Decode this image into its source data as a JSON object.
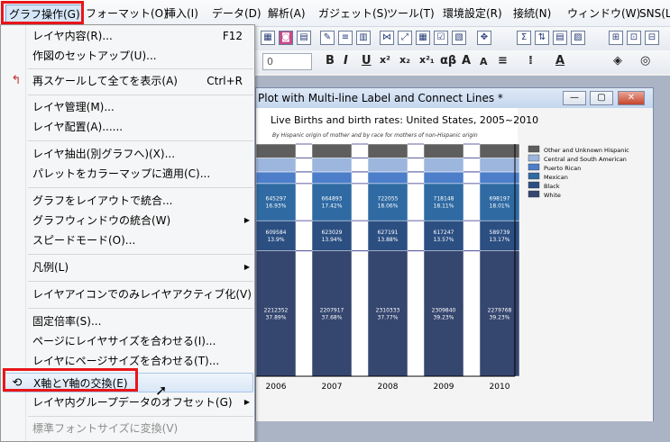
{
  "menubar": {
    "items": [
      "グラフ操作(G)",
      "フォーマット(O)",
      "挿入(I)",
      "データ(D)",
      "解析(A)",
      "ガジェット(S)",
      "ツール(T)",
      "環境設定(R)",
      "接続(N)",
      "ウィンドウ(W)",
      "SNS(L)"
    ]
  },
  "toolbar": {
    "font_size_value": "0",
    "format_glyphs": [
      "B",
      "I",
      "U",
      "x²",
      "x₂",
      "x²₁",
      "αβ",
      "A",
      "A"
    ]
  },
  "graph_window": {
    "title": "Plot with Multi-line Label and Connect Lines *",
    "buttons": [
      "—",
      "▢",
      "✕"
    ]
  },
  "colors": {
    "accent_red": "#e8161b",
    "series": [
      "#35466f",
      "#2c4f82",
      "#2f6aa3",
      "#4c7ec9",
      "#9cb6dd",
      "#5e5e5e"
    ]
  },
  "chart_data": {
    "type": "bar",
    "stacked": true,
    "title": "Live Births and birth rates: United States, 2005~2010",
    "subtitle": "By Hispanic origin of mother and by race for mothers of non-Hispanic origin",
    "categories": [
      "2006",
      "2007",
      "2008",
      "2009",
      "2010"
    ],
    "series": [
      {
        "name": "White",
        "values": [
          2212352,
          2207917,
          2310333,
          2309840,
          2279768
        ],
        "labels": [
          "2212352\n37.89%",
          "2207917\n37.68%",
          "2310333\n37.77%",
          "2309840\n39.23%",
          "2279768\n39.23%"
        ]
      },
      {
        "name": "Black",
        "values": [
          609584,
          623029,
          627191,
          617247,
          589739
        ],
        "labels": [
          "609584\n13.9%",
          "623029\n13.94%",
          "627191\n13.88%",
          "617247\n13.57%",
          "589739\n13.17%"
        ]
      },
      {
        "name": "Mexican",
        "values": [
          645297,
          664893,
          722055,
          718148,
          698197
        ],
        "labels": [
          "645297\n16.93%",
          "664893\n17.42%",
          "722055\n18.06%",
          "718148\n18.11%",
          "698197\n18.01%"
        ]
      },
      {
        "name": "Puerto Rican",
        "values": [
          0,
          0,
          0,
          0,
          0
        ]
      },
      {
        "name": "Central and South American",
        "values": [
          0,
          0,
          0,
          0,
          0
        ]
      },
      {
        "name": "Other and Unknown Hispanic",
        "values": [
          0,
          0,
          0,
          0,
          0
        ]
      }
    ],
    "legend": [
      "Other and Unknown Hispanic",
      "Central and South American",
      "Puerto Rican",
      "Mexican",
      "Black",
      "White"
    ]
  },
  "dropdown": {
    "items": [
      {
        "label": "レイヤ内容(R)...",
        "shortcut": "F12"
      },
      {
        "label": "作図のセットアップ(U)..."
      },
      {
        "label": "再スケールして全てを表示(A)",
        "shortcut": "Ctrl+R"
      },
      {
        "label": "レイヤ管理(M)..."
      },
      {
        "label": "レイヤ配置(A)......"
      },
      {
        "label": "レイヤ抽出(別グラフへ)(X)..."
      },
      {
        "label": "パレットをカラーマップに適用(C)..."
      },
      {
        "label": "グラフをレイアウトで統合..."
      },
      {
        "label": "グラフウィンドウの統合(W)"
      },
      {
        "label": "スピードモード(O)..."
      },
      {
        "label": "凡例(L)"
      },
      {
        "label": "レイヤアイコンでのみレイヤアクティブ化(V)"
      },
      {
        "label": "固定倍率(S)..."
      },
      {
        "label": "ページにレイヤサイズを合わせる(I)..."
      },
      {
        "label": "レイヤにページサイズを合わせる(T)..."
      },
      {
        "label": "X軸とY軸の交換(E)"
      },
      {
        "label": "レイヤ内グループデータのオフセット(G)"
      },
      {
        "label": "標準フォントサイズに変換(V)"
      }
    ]
  }
}
